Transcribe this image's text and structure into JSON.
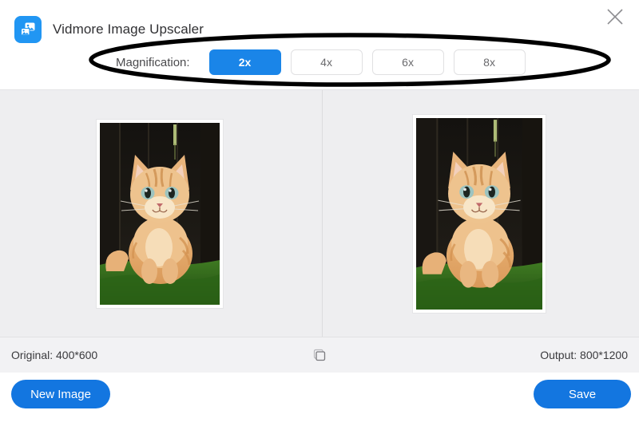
{
  "app": {
    "title": "Vidmore Image Upscaler",
    "logo_icon": "image-upscaler-logo-icon",
    "close_icon": "close-icon",
    "accent_color": "#1a85e8",
    "button_color": "#1376e0",
    "panel_bg": "#eeeef0",
    "statusbar_bg": "#f2f2f4"
  },
  "magnification": {
    "label": "Magnification:",
    "selected": "2x",
    "options": [
      {
        "label": "2x",
        "active": true
      },
      {
        "label": "4x",
        "active": false
      },
      {
        "label": "6x",
        "active": false
      },
      {
        "label": "8x",
        "active": false
      }
    ]
  },
  "preview": {
    "original_alt": "orange tabby kitten sitting on grass in front of dark wooden fence",
    "output_alt": "upscaled orange tabby kitten sitting on grass in front of dark wooden fence"
  },
  "status": {
    "original": "Original: 400*600",
    "output": "Output: 800*1200",
    "compare_icon": "copy-compare-icon"
  },
  "footer": {
    "new_image": "New Image",
    "save": "Save"
  },
  "annotation": {
    "shape": "ellipse-highlight",
    "color": "#000000"
  }
}
